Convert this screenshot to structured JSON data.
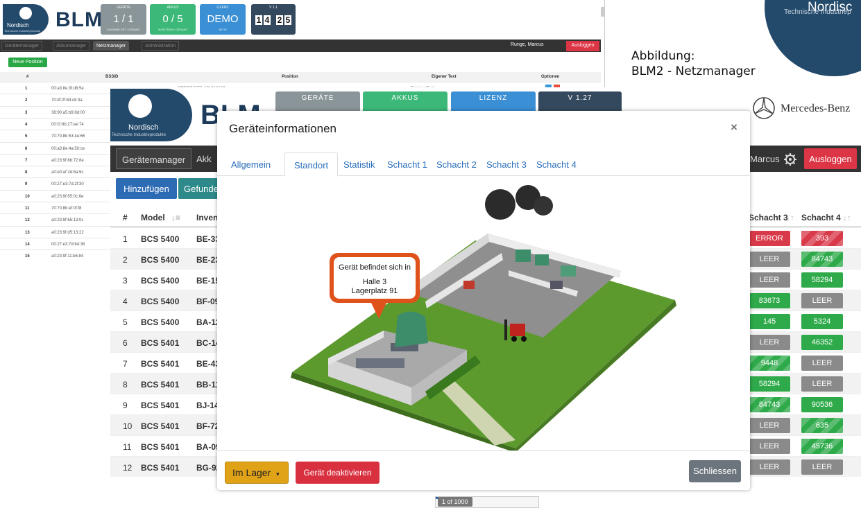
{
  "colors": {
    "navy": "#244a6b",
    "success": "#2eaa4a",
    "danger": "#d93a4a",
    "primary": "#2e6bb5",
    "warning": "#e0a318",
    "grey": "#8a8a8a"
  },
  "corner": {
    "brand": "Nordisc",
    "tagline": "Technische Industriep"
  },
  "caption": {
    "line1": "Abbildung:",
    "line2": "BLM2 - Netzmanager"
  },
  "bg": {
    "logo_text": "Nordisch",
    "logo_sub": "Technische Industrieprodukte",
    "blm": "BLM",
    "tiles": [
      {
        "cap": "GERÄTE",
        "val": "1 / 1",
        "sub": "ANGEMELDET / GESAMT"
      },
      {
        "cap": "AKKUS",
        "val": "0 / 5",
        "sub": "IN BETRIEB / GESAMT"
      },
      {
        "cap": "LIZENZ",
        "val": "DEMO",
        "sub": "AKTIV"
      }
    ],
    "clock": {
      "cap": "V 1.1",
      "digits": [
        "1",
        "4",
        "2",
        "5"
      ]
    },
    "nav": [
      "Gerätemanager",
      "Akkumanager",
      "Netzmanager",
      "Administration"
    ],
    "user": "Runge, Marcus",
    "logout": "Ausloggen",
    "new_position": "Neue Position",
    "cols": [
      "#",
      "BSSID",
      "Position",
      "Eigener Text",
      "Optionen"
    ],
    "first_row_extra": {
      "pos": "ORDST-5555-AB-010A02",
      "text": "Eigener Text"
    },
    "rows": [
      [
        "1",
        "00:a3:8e:3f:d8:5e"
      ],
      [
        "2",
        "70:df:2f:8d:c8:3a"
      ],
      [
        "3",
        "38:90:a5:b9:8d:00"
      ],
      [
        "4",
        "00:f2:8b:27:ee:74"
      ],
      [
        "5",
        "70:70:8b:53:4e:66"
      ],
      [
        "6",
        "00:a3:8e:4a:50:ce"
      ],
      [
        "7",
        "a0:23:9f:8b:72:8e"
      ],
      [
        "8",
        "a0:e0:af:2d:6a:9c"
      ],
      [
        "9",
        "00:27:e3:7d:2f:30"
      ],
      [
        "10",
        "a0:23:9f:65:0c:6e"
      ],
      [
        "11",
        "70:70:8b:ef:0f:f8"
      ],
      [
        "12",
        "a0:23:9f:65:13:0c"
      ],
      [
        "13",
        "a0:23:9f:d5:13:22"
      ],
      [
        "14",
        "00:27:e3:7d:64:38"
      ],
      [
        "15",
        "a0:23:9f:11:b6:84"
      ]
    ]
  },
  "main": {
    "logo_text": "Nordisch",
    "logo_sub": "Technische Industrieprodukte",
    "blm": "BLM",
    "tiles": [
      "GERÄTE",
      "AKKUS",
      "LIZENZ",
      "V 1.27"
    ],
    "brand": "Mercedes-Benz",
    "nav_active": "Gerätemanager",
    "nav_next": "Akk",
    "user": "Marcus",
    "logout": "Ausloggen",
    "add": "Hinzufügen",
    "found": "Gefunde",
    "cols": {
      "num": "#",
      "model": "Model",
      "inv": "Inven",
      "s3": "Schacht 3",
      "s4": "Schacht 4"
    },
    "rows": [
      {
        "n": "1",
        "model": "BCS 5400",
        "inv": "BE-33",
        "s3": "ERROR",
        "s3c": "red",
        "s4": "393",
        "s4c": "red stripe"
      },
      {
        "n": "2",
        "model": "BCS 5400",
        "inv": "BE-23",
        "s3": "LEER",
        "s3c": "grey",
        "s4": "84743",
        "s4c": "green stripe"
      },
      {
        "n": "3",
        "model": "BCS 5400",
        "inv": "BE-15",
        "s3": "LEER",
        "s3c": "grey",
        "s4": "58294",
        "s4c": "green"
      },
      {
        "n": "4",
        "model": "BCS 5400",
        "inv": "BF-09",
        "s3": "83673",
        "s3c": "green",
        "s4": "LEER",
        "s4c": "grey"
      },
      {
        "n": "5",
        "model": "BCS 5400",
        "inv": "BA-12",
        "s3": "145",
        "s3c": "green",
        "s4": "5324",
        "s4c": "green"
      },
      {
        "n": "6",
        "model": "BCS 5401",
        "inv": "BC-14",
        "s3": "LEER",
        "s3c": "grey",
        "s4": "46352",
        "s4c": "green"
      },
      {
        "n": "7",
        "model": "BCS 5401",
        "inv": "BE-43",
        "s3": "9448",
        "s3c": "green stripe",
        "s4": "LEER",
        "s4c": "grey"
      },
      {
        "n": "8",
        "model": "BCS 5401",
        "inv": "BB-11",
        "s3": "58294",
        "s3c": "green",
        "s4": "LEER",
        "s4c": "grey"
      },
      {
        "n": "9",
        "model": "BCS 5401",
        "inv": "BJ-14",
        "s3": "84743",
        "s3c": "green stripe",
        "s4": "90536",
        "s4c": "green"
      },
      {
        "n": "10",
        "model": "BCS 5401",
        "inv": "BF-72",
        "s3": "LEER",
        "s3c": "grey",
        "s4": "635",
        "s4c": "green stripe"
      },
      {
        "n": "11",
        "model": "BCS 5401",
        "inv": "BA-09",
        "s3": "LEER",
        "s3c": "grey",
        "s4": "45736",
        "s4c": "green stripe"
      },
      {
        "n": "12",
        "model": "BCS 5401",
        "inv": "BG-92",
        "s3": "LEER",
        "s3c": "grey",
        "s4": "LEER",
        "s4c": "grey"
      }
    ],
    "pager": "1 of 1000"
  },
  "modal": {
    "title": "Geräteinformationen",
    "close": "×",
    "tabs": [
      "Allgemein",
      "Standort",
      "Statistik",
      "Schacht 1",
      "Schacht 2",
      "Schacht 3",
      "Schacht 4"
    ],
    "active_tab": "Standort",
    "bubble": {
      "line1": "Gerät befindet sich in",
      "line2": "Halle 3",
      "line3": "Lagerplatz 91"
    },
    "btn_lager": "Im Lager",
    "btn_deactivate": "Gerät deaktivieren",
    "btn_close": "Schliessen"
  }
}
